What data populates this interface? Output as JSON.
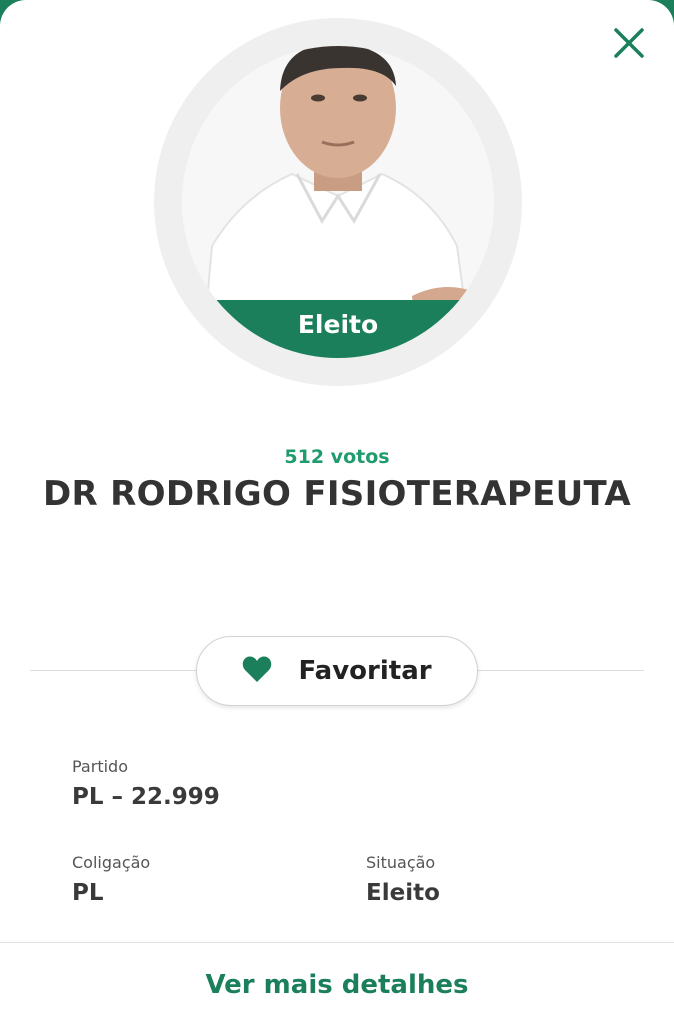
{
  "colors": {
    "accent": "#1a7f5a",
    "accent_text": "#1f9c6d",
    "text_dark": "#333333"
  },
  "candidate": {
    "status_badge": "Eleito",
    "votes": "512 votos",
    "name": "DR RODRIGO FISIOTERAPEUTA"
  },
  "actions": {
    "favorite_label": "Favoritar",
    "favorite_icon": "heart-icon",
    "close_icon": "close-icon",
    "details_link": "Ver mais detalhes"
  },
  "info": {
    "partido": {
      "label": "Partido",
      "value": "PL – 22.999"
    },
    "coligacao": {
      "label": "Coligação",
      "value": "PL"
    },
    "situacao": {
      "label": "Situação",
      "value": "Eleito"
    }
  }
}
